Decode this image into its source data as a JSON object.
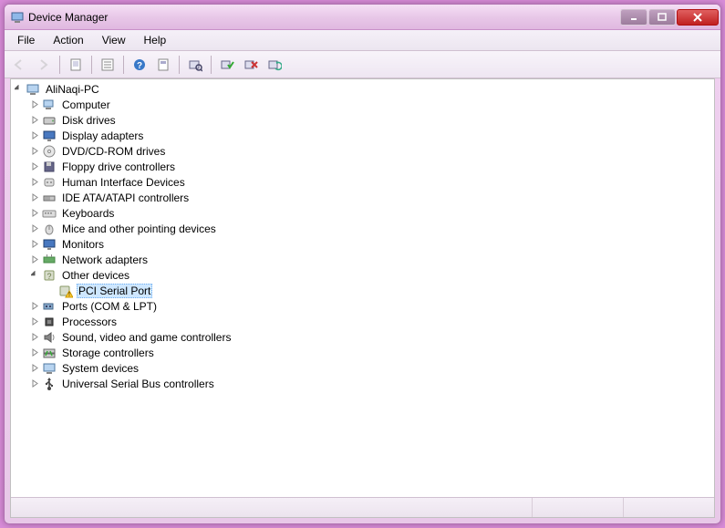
{
  "window": {
    "title": "Device Manager"
  },
  "menubar": {
    "items": [
      "File",
      "Action",
      "View",
      "Help"
    ]
  },
  "toolbar": {
    "buttons": [
      {
        "name": "back-button",
        "icon": "arrow-left",
        "enabled": false
      },
      {
        "name": "forward-button",
        "icon": "arrow-right",
        "enabled": false
      },
      {
        "sep": true
      },
      {
        "name": "show-hidden-button",
        "icon": "page"
      },
      {
        "sep": true
      },
      {
        "name": "properties-button",
        "icon": "properties"
      },
      {
        "sep": true
      },
      {
        "name": "help-button",
        "icon": "help"
      },
      {
        "name": "uninstall-button",
        "icon": "page2"
      },
      {
        "sep": true
      },
      {
        "name": "update-driver-button",
        "icon": "scan"
      },
      {
        "sep": true
      },
      {
        "name": "enable-button",
        "icon": "enable"
      },
      {
        "name": "disable-button",
        "icon": "disable"
      },
      {
        "name": "scan-hardware-button",
        "icon": "refresh"
      }
    ]
  },
  "tree": {
    "root": {
      "label": "AliNaqi-PC",
      "icon": "computer",
      "expanded": true,
      "children": [
        {
          "label": "Computer",
          "icon": "computer-small",
          "expanded": false
        },
        {
          "label": "Disk drives",
          "icon": "disk",
          "expanded": false
        },
        {
          "label": "Display adapters",
          "icon": "display",
          "expanded": false
        },
        {
          "label": "DVD/CD-ROM drives",
          "icon": "dvd",
          "expanded": false
        },
        {
          "label": "Floppy drive controllers",
          "icon": "floppy",
          "expanded": false
        },
        {
          "label": "Human Interface Devices",
          "icon": "hid",
          "expanded": false
        },
        {
          "label": "IDE ATA/ATAPI controllers",
          "icon": "ide",
          "expanded": false
        },
        {
          "label": "Keyboards",
          "icon": "keyboard",
          "expanded": false
        },
        {
          "label": "Mice and other pointing devices",
          "icon": "mouse",
          "expanded": false
        },
        {
          "label": "Monitors",
          "icon": "monitor",
          "expanded": false
        },
        {
          "label": "Network adapters",
          "icon": "network",
          "expanded": false
        },
        {
          "label": "Other devices",
          "icon": "other",
          "expanded": true,
          "children": [
            {
              "label": "PCI Serial Port",
              "icon": "warning",
              "selected": true,
              "leaf": true
            }
          ]
        },
        {
          "label": "Ports (COM & LPT)",
          "icon": "ports",
          "expanded": false
        },
        {
          "label": "Processors",
          "icon": "cpu",
          "expanded": false
        },
        {
          "label": "Sound, video and game controllers",
          "icon": "sound",
          "expanded": false
        },
        {
          "label": "Storage controllers",
          "icon": "storage",
          "expanded": false
        },
        {
          "label": "System devices",
          "icon": "system",
          "expanded": false
        },
        {
          "label": "Universal Serial Bus controllers",
          "icon": "usb",
          "expanded": false
        }
      ]
    }
  }
}
